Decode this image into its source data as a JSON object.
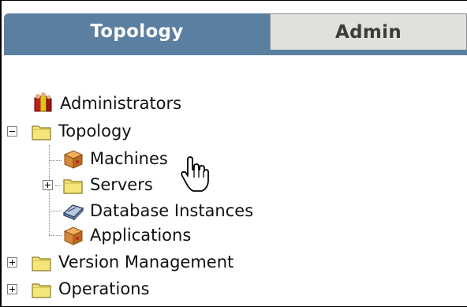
{
  "tabs": [
    {
      "label": "Topology",
      "active": true
    },
    {
      "label": "Admin",
      "active": false
    }
  ],
  "tree": {
    "administrators": {
      "label": "Administrators",
      "icon": "administrators-icon"
    },
    "topology": {
      "label": "Topology",
      "icon": "folder-open-icon",
      "expanded": true
    },
    "machines": {
      "label": "Machines",
      "icon": "machine-box-icon"
    },
    "servers": {
      "label": "Servers",
      "icon": "folder-icon",
      "expanded": false
    },
    "database_instances": {
      "label": "Database Instances",
      "icon": "database-icon"
    },
    "applications": {
      "label": "Applications",
      "icon": "application-box-icon"
    },
    "version_management": {
      "label": "Version Management",
      "icon": "folder-icon",
      "expanded": false
    },
    "operations": {
      "label": "Operations",
      "icon": "folder-icon",
      "expanded": false
    }
  },
  "colors": {
    "active_tab": "#5a7fa0",
    "inactive_tab": "#e0e0dc",
    "folder": "#f5e67a"
  }
}
